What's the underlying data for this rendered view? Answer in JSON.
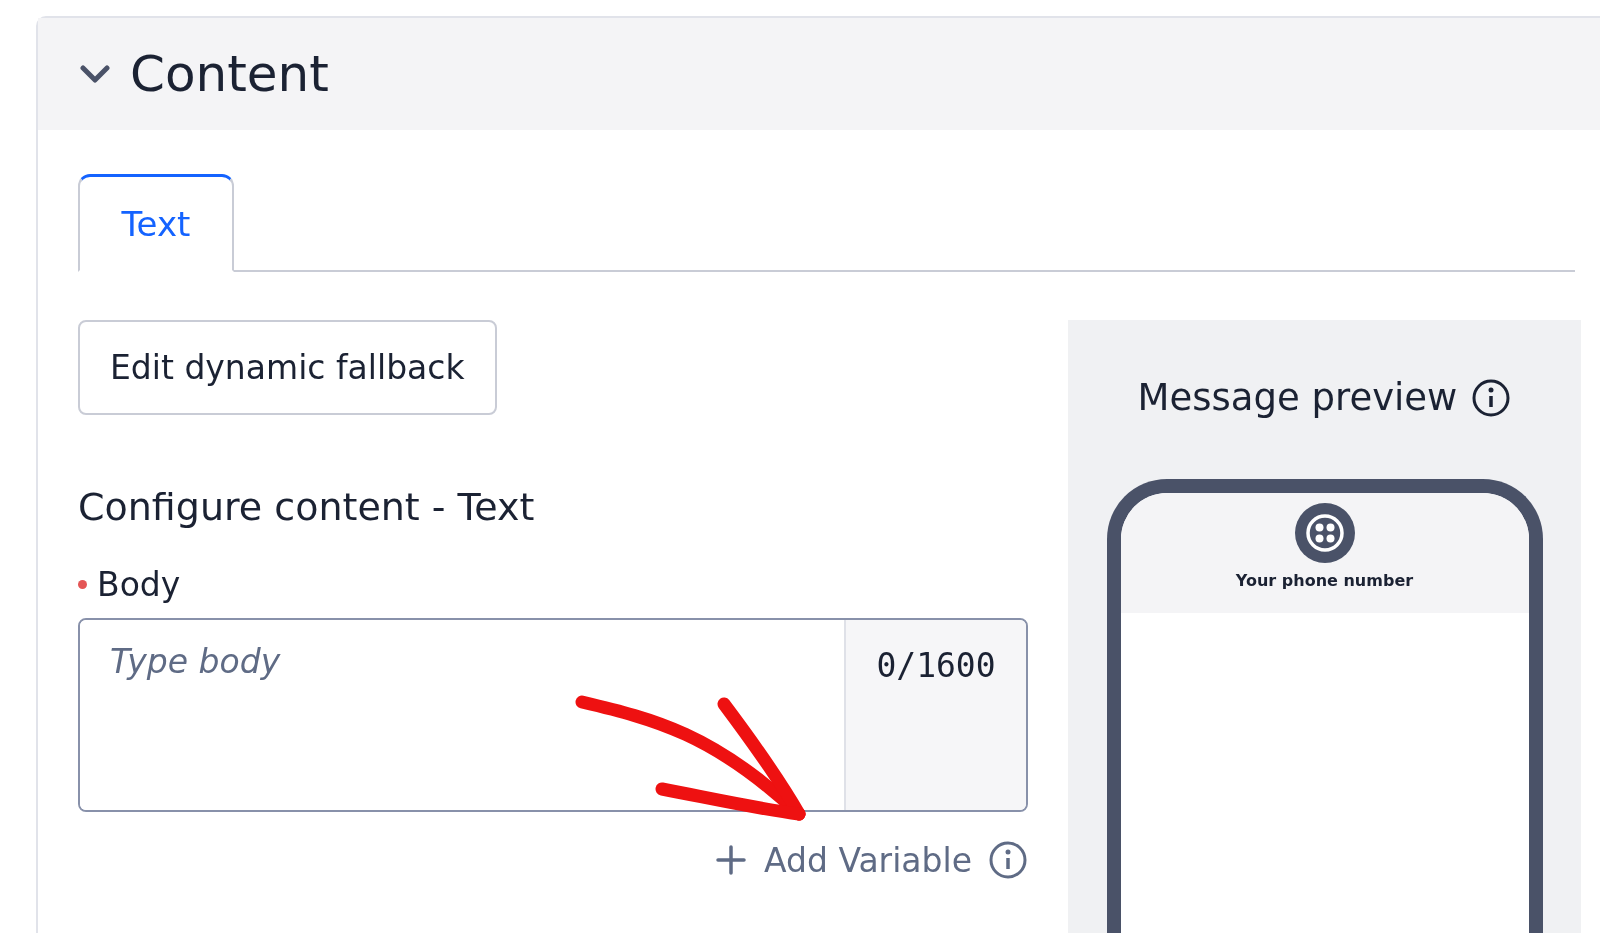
{
  "section": {
    "title": "Content",
    "expanded": true
  },
  "tabs": [
    {
      "label": "Text",
      "selected": true
    }
  ],
  "fallback_button": "Edit dynamic fallback",
  "configure_title": "Configure content - Text",
  "body_field": {
    "label": "Body",
    "required": true,
    "placeholder": "Type body",
    "counter": "0/1600"
  },
  "add_variable": "Add Variable",
  "preview": {
    "title": "Message preview",
    "phone_label": "Your phone number"
  }
}
